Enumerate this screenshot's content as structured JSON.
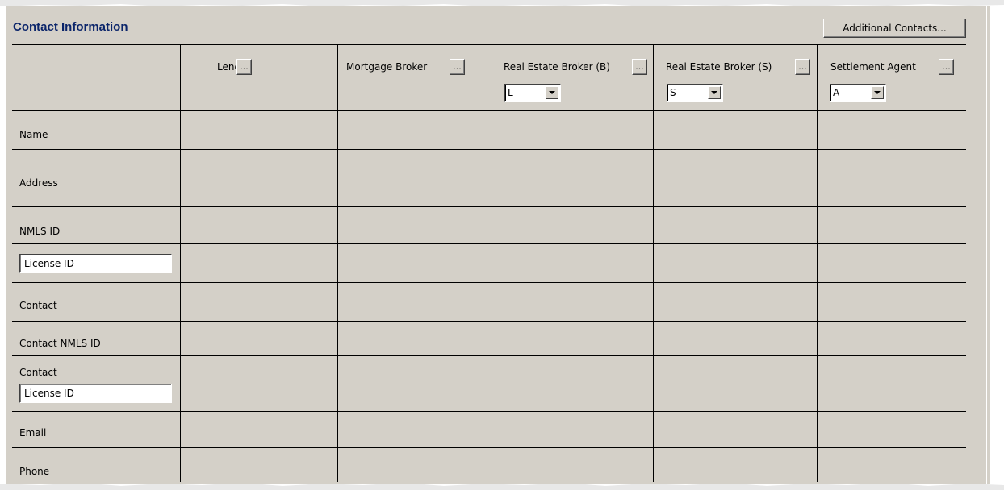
{
  "panel": {
    "title": "Contact Information",
    "additional_contacts_label": "Additional Contacts..."
  },
  "columns": [
    {
      "label": "Lender",
      "button_label": "...",
      "select": null
    },
    {
      "label": "Mortgage Broker",
      "button_label": "...",
      "select": null
    },
    {
      "label": "Real Estate Broker (B)",
      "button_label": "...",
      "select": "L"
    },
    {
      "label": "Real Estate Broker (S)",
      "button_label": "...",
      "select": "S"
    },
    {
      "label": "Settlement Agent",
      "button_label": "...",
      "select": "A"
    }
  ],
  "rows": {
    "name": "Name",
    "address": "Address",
    "nmls_id": "NMLS ID",
    "license_id_value": "License ID",
    "contact": "Contact",
    "contact_nmls_id": "Contact NMLS ID",
    "contact_license_label": "Contact",
    "contact_license_value": "License ID",
    "email": "Email",
    "phone": "Phone"
  },
  "colors": {
    "panel_bg": "#d4d0c8",
    "title": "#0a246a",
    "grid": "#000000"
  }
}
